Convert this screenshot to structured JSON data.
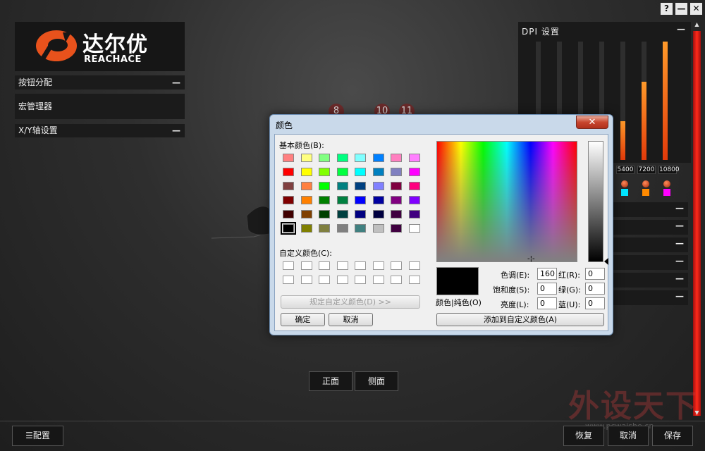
{
  "window": {
    "help": "?",
    "minimize": "—",
    "close": "✕"
  },
  "logo": {
    "cn": "达尔优",
    "en": "REACHACE"
  },
  "left": {
    "button_assign": "按钮分配",
    "macro_manager": "宏管理器",
    "xy_axis": "X/Y轴设置",
    "collapse": "—"
  },
  "dpi": {
    "title": "DPI 设置",
    "collapse": "—",
    "levels": [
      {
        "fill": 0.0
      },
      {
        "fill": 0.0
      },
      {
        "fill": 0.0
      },
      {
        "fill": 0.0
      },
      {
        "fill": 0.33
      },
      {
        "fill": 0.66
      },
      {
        "fill": 1.0
      }
    ],
    "labels": [
      "5400",
      "7200",
      "10800"
    ],
    "swatch_colors": [
      "#00e5ff",
      "#ff8a00",
      "#ff00ff"
    ]
  },
  "right_rows": [
    "—",
    "—",
    "—",
    "—",
    "—",
    "—"
  ],
  "badges": [
    "8",
    "10",
    "11"
  ],
  "views": {
    "front": "正面",
    "side": "侧面"
  },
  "bottom": {
    "config": "配置",
    "restore": "恢复",
    "cancel": "取消",
    "save": "保存"
  },
  "watermark": {
    "text": "外设天下",
    "url": "www.pcwaishe.cn"
  },
  "dialog": {
    "title": "颜色",
    "close": "✕",
    "basic_colors_label": "基本颜色(B):",
    "basic_colors": [
      [
        "#ff8080",
        "#ffff80",
        "#80ff80",
        "#00ff80",
        "#80ffff",
        "#0080ff",
        "#ff80c0",
        "#ff80ff"
      ],
      [
        "#ff0000",
        "#ffff00",
        "#80ff00",
        "#00ff40",
        "#00ffff",
        "#0080c0",
        "#8080c0",
        "#ff00ff"
      ],
      [
        "#804040",
        "#ff8040",
        "#00ff00",
        "#008080",
        "#004080",
        "#8080ff",
        "#800040",
        "#ff0080"
      ],
      [
        "#800000",
        "#ff8000",
        "#008000",
        "#008040",
        "#0000ff",
        "#0000a0",
        "#800080",
        "#8000ff"
      ],
      [
        "#400000",
        "#804000",
        "#004000",
        "#004040",
        "#000080",
        "#000040",
        "#400040",
        "#400080"
      ],
      [
        "#000000",
        "#808000",
        "#808040",
        "#808080",
        "#408080",
        "#c0c0c0",
        "#400040",
        "#ffffff"
      ]
    ],
    "custom_colors_label": "自定义颜色(C):",
    "define_custom": "规定自定义颜色(D) >>",
    "ok": "确定",
    "cancel": "取消",
    "color_solid": "颜色|纯色(O)",
    "hue_label": "色调(E):",
    "hue": "160",
    "sat_label": "饱和度(S):",
    "sat": "0",
    "lum_label": "亮度(L):",
    "lum": "0",
    "red_label": "红(R):",
    "red": "0",
    "green_label": "绿(G):",
    "green": "0",
    "blue_label": "蓝(U):",
    "blue": "0",
    "add_custom": "添加到自定义颜色(A)"
  }
}
